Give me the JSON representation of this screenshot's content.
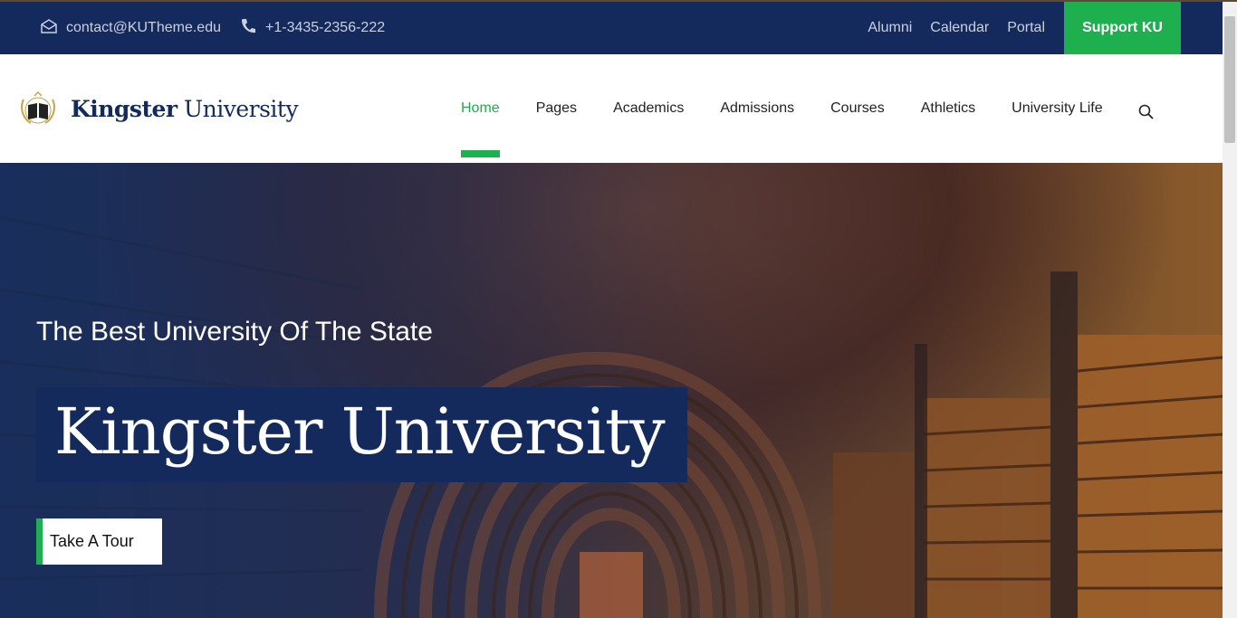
{
  "topbar": {
    "email": "contact@KUTheme.edu",
    "phone": "+1-3435-2356-222",
    "links": [
      "Alumni",
      "Calendar",
      "Portal"
    ],
    "support_label": "Support KU",
    "email_icon": "envelope-icon",
    "phone_icon": "phone-icon"
  },
  "header": {
    "logo_bold": "Kingster",
    "logo_rest": " University",
    "nav": [
      "Home",
      "Pages",
      "Academics",
      "Admissions",
      "Courses",
      "Athletics",
      "University Life"
    ],
    "active_nav": "Home",
    "search_icon": "search-icon"
  },
  "hero": {
    "subtitle": "The Best University Of The State",
    "title": "Kingster University",
    "cta_label": "Take A Tour"
  },
  "colors": {
    "navy": "#142a5c",
    "green": "#1eb04e"
  }
}
